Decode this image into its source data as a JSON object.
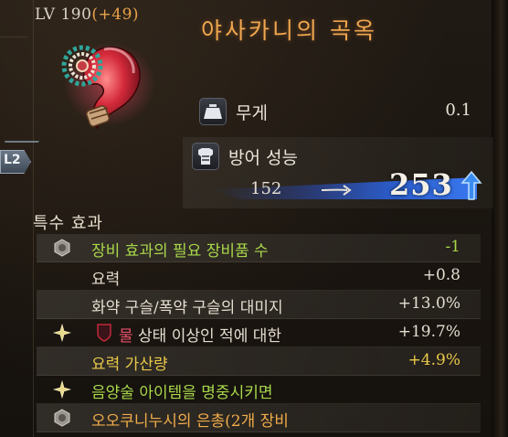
{
  "item": {
    "level_label": "LV 190",
    "level_bonus": "(+49)",
    "name": "야사카니의 곡옥"
  },
  "tab_badge": "L2",
  "weight": {
    "label": "무게",
    "value": "0.1",
    "icon": "weight-icon"
  },
  "defense": {
    "label": "방어 성능",
    "old": "152",
    "new": "253",
    "icon": "armor-icon",
    "increase_color": "#3a8cf0"
  },
  "special": {
    "title": "특수 효과",
    "rows": [
      {
        "icon": "hex-icon",
        "label": "장비 효과의 필요 장비품 수",
        "value": "-1",
        "color": "#a8d84a"
      },
      {
        "icon": "",
        "label": "요력",
        "value": "+0.8",
        "color": "#e4ddd0"
      },
      {
        "icon": "",
        "label": "화약 구슬/폭약 구슬의 대미지",
        "value": "+13.0%",
        "color": "#e4ddd0"
      },
      {
        "icon": "star-icon",
        "prefix": "물",
        "label": "상태 이상인 적에 대한",
        "value": "+19.7%",
        "color": "#e4ddd0"
      },
      {
        "icon": "",
        "label": "요력 가산량",
        "value": "+4.9%",
        "color": "#e9c94a"
      },
      {
        "icon": "star-icon",
        "label": "음양술 아이템을 명중시키면",
        "value": "",
        "color": "#a8d84a"
      },
      {
        "icon": "hex-icon",
        "label": "오오쿠니누시의 은총(2개 장비",
        "value": "",
        "color": "#f0ac4a"
      }
    ]
  }
}
